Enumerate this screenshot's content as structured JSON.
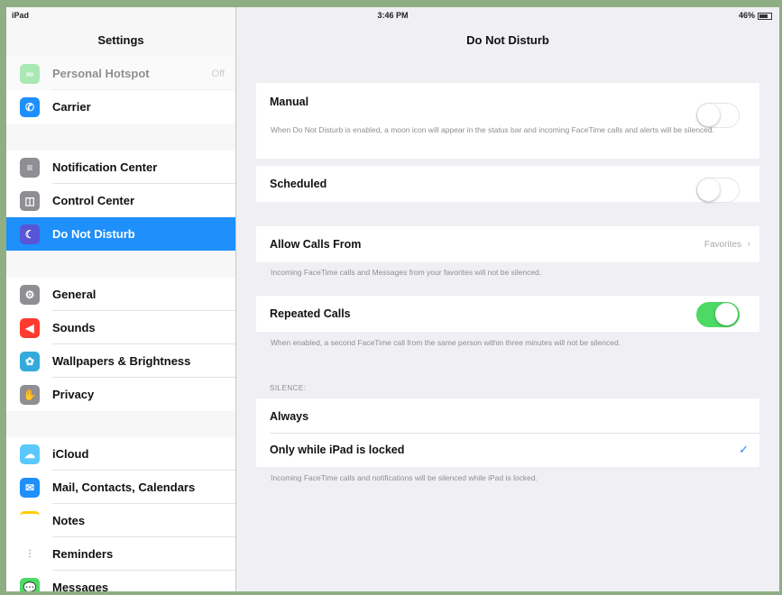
{
  "status_bar": {
    "device": "iPad",
    "time": "3:46 PM",
    "battery": "46%"
  },
  "sidebar": {
    "title": "Settings",
    "items": [
      {
        "label": "Personal Hotspot",
        "value": "Off",
        "icon": "hotspot-icon",
        "color": "#4cd964"
      },
      {
        "label": "Carrier",
        "icon": "phone-icon",
        "color": "#1e8ffb"
      },
      {
        "label": "Notification Center",
        "icon": "notification-center-icon",
        "color": "#8e8e93"
      },
      {
        "label": "Control Center",
        "icon": "control-center-icon",
        "color": "#8e8e93"
      },
      {
        "label": "Do Not Disturb",
        "icon": "moon-icon",
        "color": "#5856d6"
      },
      {
        "label": "General",
        "icon": "gear-icon",
        "color": "#8e8e93"
      },
      {
        "label": "Sounds",
        "icon": "speaker-icon",
        "color": "#ff3b30"
      },
      {
        "label": "Wallpapers & Brightness",
        "icon": "flower-icon",
        "color": "#34aadc"
      },
      {
        "label": "Privacy",
        "icon": "hand-icon",
        "color": "#8e8e93"
      },
      {
        "label": "iCloud",
        "icon": "cloud-icon",
        "color": "#5ac8fa"
      },
      {
        "label": "Mail, Contacts, Calendars",
        "icon": "mail-icon",
        "color": "#1e8ffb"
      },
      {
        "label": "Notes",
        "icon": "notes-icon",
        "color": "#ffcc00"
      },
      {
        "label": "Reminders",
        "icon": "reminders-icon",
        "color": "#ffffff"
      },
      {
        "label": "Messages",
        "icon": "messages-icon",
        "color": "#4cd964"
      }
    ]
  },
  "detail": {
    "title": "Do Not Disturb",
    "manual": {
      "label": "Manual",
      "on": false,
      "footer": "When Do Not Disturb is enabled, a moon icon will appear in the status bar and incoming FaceTime calls and alerts will be silenced."
    },
    "scheduled": {
      "label": "Scheduled",
      "on": false
    },
    "allow_calls": {
      "label": "Allow Calls From",
      "value": "Favorites",
      "footer": "Incoming FaceTime calls and Messages from your favorites will not be silenced."
    },
    "repeated_calls": {
      "label": "Repeated Calls",
      "on": true,
      "footer": "When enabled, a second FaceTime call from the same person within three minutes will not be silenced."
    },
    "silence": {
      "header": "SILENCE:",
      "options": [
        "Always",
        "Only while iPad is locked"
      ],
      "selected_index": 1,
      "footer": "Incoming FaceTime calls and notifications will be silenced while iPad is locked."
    }
  },
  "colors": {
    "accent": "#1e8ffb",
    "toggle_on": "#4cd964",
    "background": "#efeff4"
  }
}
